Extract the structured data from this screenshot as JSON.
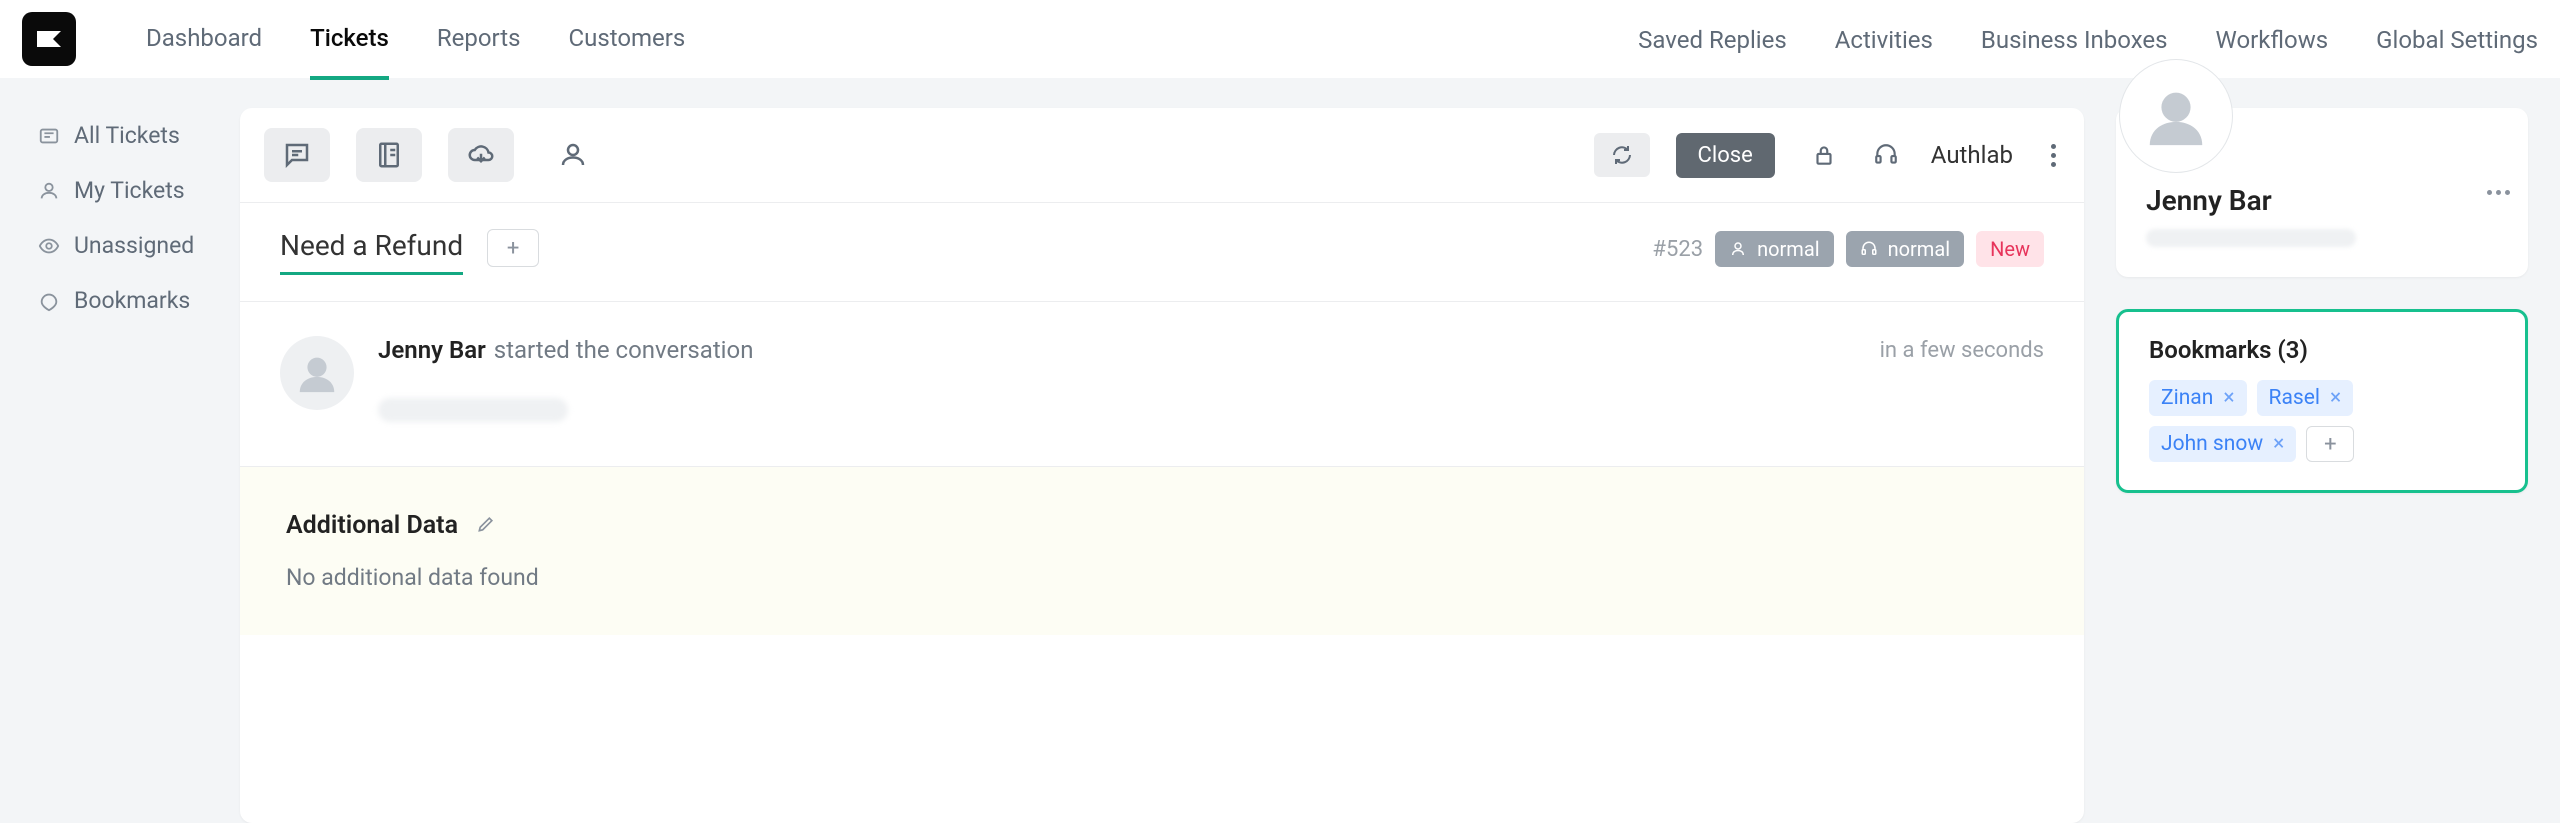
{
  "topnav": {
    "left": [
      "Dashboard",
      "Tickets",
      "Reports",
      "Customers"
    ],
    "right": [
      "Saved Replies",
      "Activities",
      "Business Inboxes",
      "Workflows",
      "Global Settings"
    ],
    "active_index": 1
  },
  "sidebar": {
    "items": [
      {
        "label": "All Tickets"
      },
      {
        "label": "My Tickets"
      },
      {
        "label": "Unassigned"
      },
      {
        "label": "Bookmarks"
      }
    ]
  },
  "toolbar": {
    "close_label": "Close",
    "agent": "Authlab"
  },
  "ticket": {
    "title": "Need a Refund",
    "id": "#523",
    "priority": "normal",
    "channel": "normal",
    "status": "New"
  },
  "conversation": {
    "author": "Jenny Bar",
    "action": "started the conversation",
    "time": "in a few seconds"
  },
  "additional": {
    "title": "Additional Data",
    "empty": "No additional data found"
  },
  "user": {
    "name": "Jenny Bar"
  },
  "bookmarks": {
    "title": "Bookmarks (3)",
    "tags": [
      "Zinan",
      "Rasel",
      "John snow"
    ]
  }
}
